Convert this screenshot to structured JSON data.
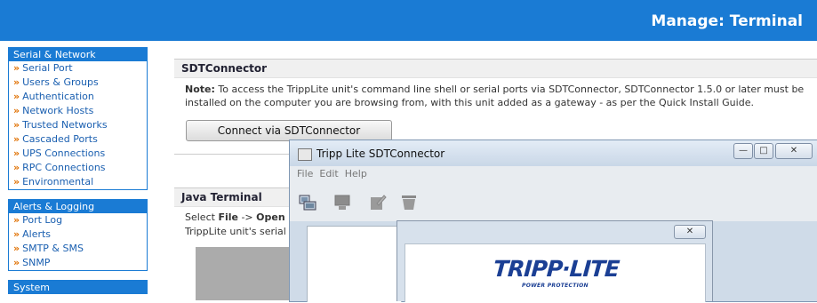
{
  "header": {
    "title": "Manage: Terminal",
    "bg_color": "#1a7bd4"
  },
  "sidebar": {
    "sections": [
      {
        "heading": "Serial & Network",
        "items": [
          "Serial Port",
          "Users & Groups",
          "Authentication",
          "Network Hosts",
          "Trusted Networks",
          "Cascaded Ports",
          "UPS Connections",
          "RPC Connections",
          "Environmental"
        ]
      },
      {
        "heading": "Alerts & Logging",
        "items": [
          "Port Log",
          "Alerts",
          "SMTP & SMS",
          "SNMP"
        ]
      },
      {
        "heading": "System",
        "items": []
      }
    ],
    "bullet": "»"
  },
  "main": {
    "sdt_heading": "SDTConnector",
    "note_label": "Note:",
    "note_text": " To access the TrippLite unit's command line shell or serial ports via SDTConnector, SDTConnector 1.5.0 or later must be installed on the computer you are browsing from, with this unit added as a gateway - as per the Quick Install Guide.",
    "connect_button": "Connect via SDTConnector",
    "java_heading": "Java Terminal",
    "java_select": "Select ",
    "java_file": "File",
    "java_arrow": " -> ",
    "java_open": "Open S",
    "java_line2": "TrippLite unit's serial p"
  },
  "sdt_window": {
    "title": "Tripp Lite SDTConnector",
    "menu": [
      "File",
      "Edit",
      "Help"
    ],
    "min_glyph": "—",
    "max_glyph": "□",
    "close_glyph": "✕"
  },
  "about_dialog": {
    "close_glyph": "✕",
    "logo_text": "TRIPP·LITE",
    "logo_sub": "POWER PROTECTION"
  }
}
